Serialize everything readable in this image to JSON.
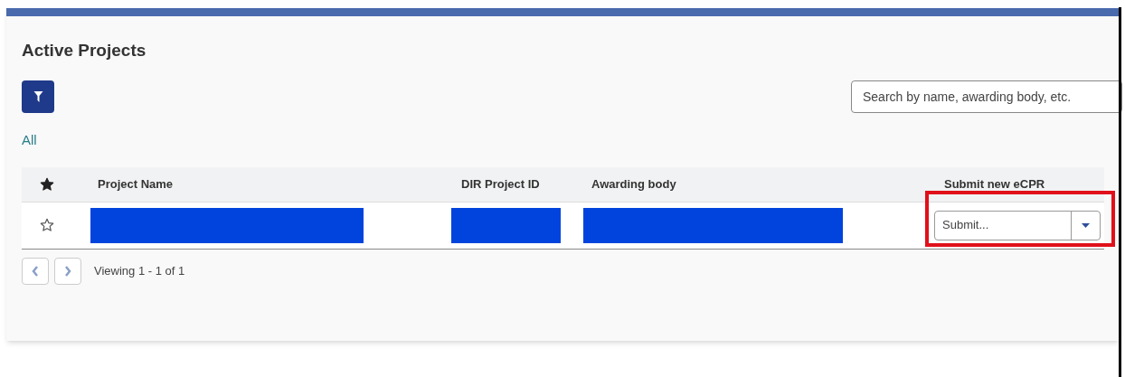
{
  "title": "Active Projects",
  "filter_link": "All",
  "search": {
    "placeholder": "Search by name, awarding body, etc."
  },
  "table": {
    "columns": [
      {
        "kind": "star"
      },
      {
        "kind": "text",
        "label": "Project Name"
      },
      {
        "kind": "text",
        "label": "DIR Project ID"
      },
      {
        "kind": "text",
        "label": "Awarding body"
      },
      {
        "kind": "text",
        "label": "Submit new eCPR"
      }
    ],
    "rows": [
      {
        "starred": false,
        "submit": {
          "placeholder": "Submit...",
          "highlighted": true
        }
      }
    ]
  },
  "pagination": {
    "text": "Viewing 1 - 1 of 1"
  }
}
